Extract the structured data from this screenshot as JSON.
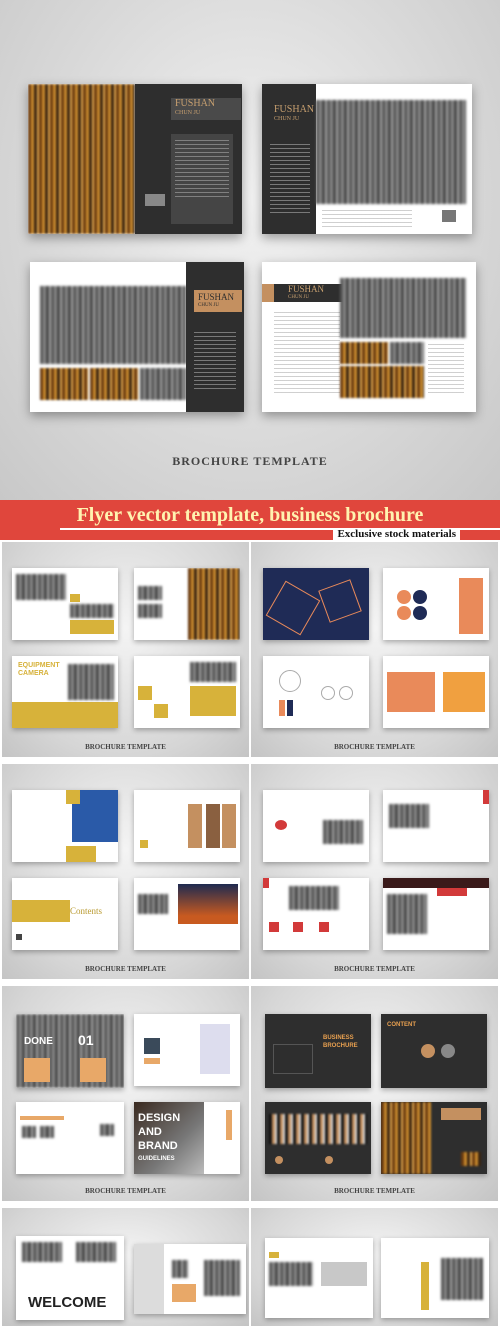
{
  "hero": {
    "spreads": [
      {
        "title_line1": "FUSHAN",
        "title_line2": "CHUN JU"
      },
      {
        "title_line1": "FUSHAN",
        "title_line2": "CHUN JU"
      },
      {
        "title_line1": "FUSHAN",
        "title_line2": "CHUN JU"
      },
      {
        "title_line1": "FUSHAN",
        "title_line2": "CHUN JU"
      }
    ],
    "caption": "BROCHURE TEMPLATE"
  },
  "banner": {
    "title": "Flyer vector template, business brochure",
    "subtitle": "Exclusive stock materials"
  },
  "grid": {
    "caption": "BROCHURE TEMPLATE",
    "labels": {
      "equipment": "EQUIPMENT CAMERA",
      "contents": "Contents",
      "done": "DONE",
      "num01": "01",
      "design1": "DESIGN",
      "design2": "AND",
      "design3": "BRAND",
      "design4": "GUIDELINES",
      "business": "BUSINESS BROCHURE",
      "content": "CONTENT",
      "welcome": "WELCOME"
    }
  },
  "colors": {
    "banner": "#e0463c",
    "accent_gold": "#d7b23a",
    "accent_orange": "#e98a5a",
    "dark_page": "#2e2e2e"
  }
}
